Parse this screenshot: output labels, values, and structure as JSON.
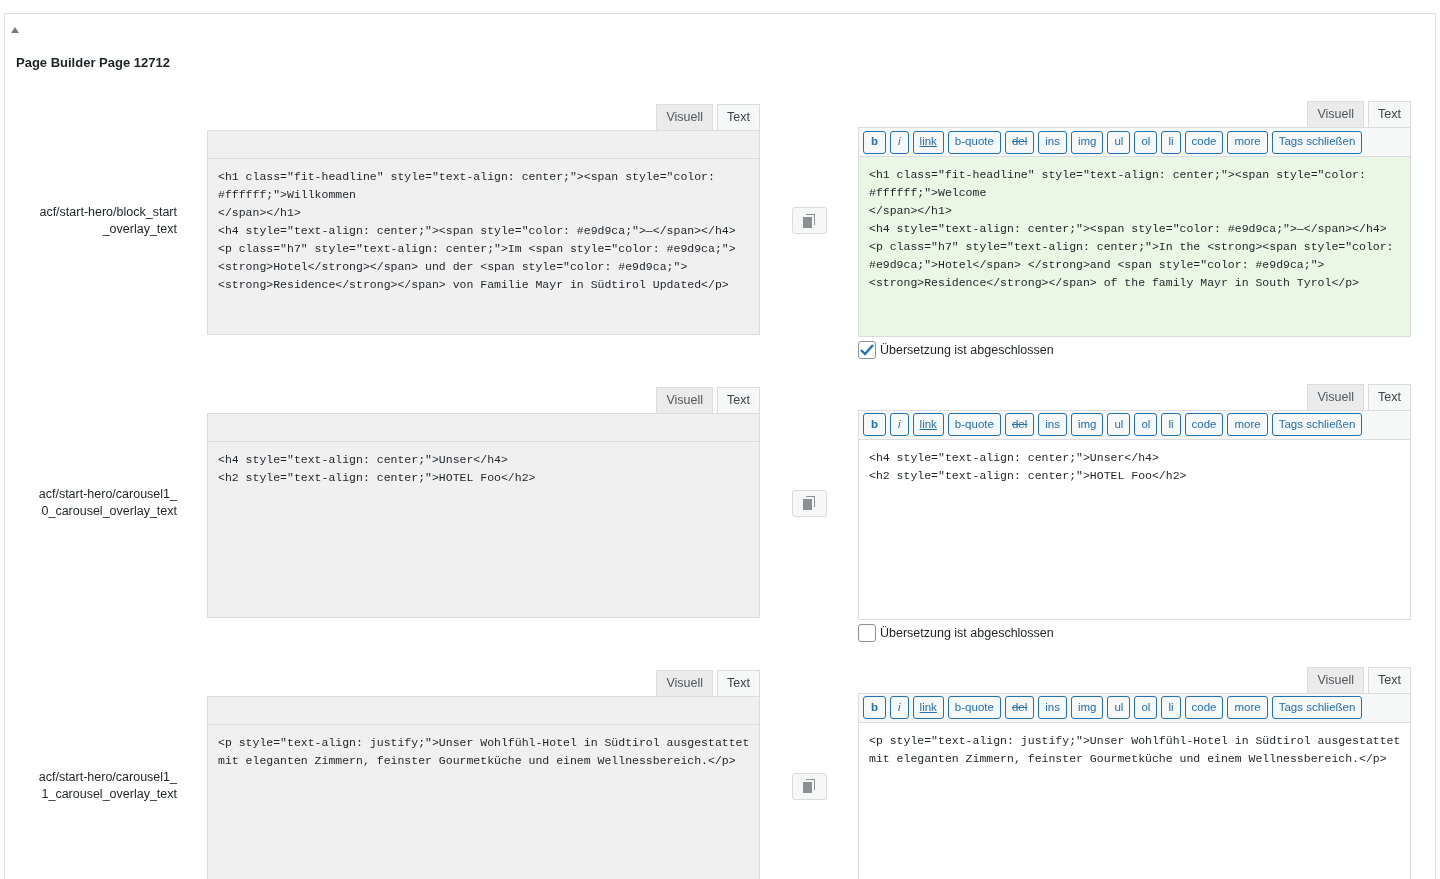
{
  "page": {
    "title": "Page Builder Page 12712"
  },
  "fields": [
    {
      "label": "acf/start-hero/block_start_overlay_text",
      "source": {
        "tabs": [
          {
            "label": "Visuell",
            "selected": false
          },
          {
            "label": "Text",
            "selected": true
          }
        ],
        "code_lines": [
          "<h1 class=\"fit-headline\" style=\"text-align: center;\"><span style=\"color:",
          "#ffffff;\">Willkommen",
          "</span></h1>",
          "<h4 style=\"text-align: center;\"><span style=\"color: #e9d9ca;\">—</span></h4>",
          "<p class=\"h7\" style=\"text-align: center;\">Im <span style=\"color: #e9d9ca;\">",
          "<strong>Hotel</strong></span> und der <span style=\"color: #e9d9ca;\">",
          "<strong>Residence</strong></span> von Familie Mayr in Südtirol Updated</p>"
        ]
      },
      "translation": {
        "tabs": [
          {
            "label": "Visuell",
            "selected": false
          },
          {
            "label": "Text",
            "selected": true
          }
        ],
        "toolbar": [
          {
            "label": "b",
            "kind": "bold"
          },
          {
            "label": "i",
            "kind": "italic"
          },
          {
            "label": "link",
            "kind": "link"
          },
          {
            "label": "b-quote",
            "kind": "plain"
          },
          {
            "label": "del",
            "kind": "strike"
          },
          {
            "label": "ins",
            "kind": "plain"
          },
          {
            "label": "img",
            "kind": "plain"
          },
          {
            "label": "ul",
            "kind": "plain"
          },
          {
            "label": "ol",
            "kind": "plain"
          },
          {
            "label": "li",
            "kind": "plain"
          },
          {
            "label": "code",
            "kind": "plain"
          },
          {
            "label": "more",
            "kind": "plain"
          },
          {
            "label": "Tags schließen",
            "kind": "plain"
          }
        ],
        "code_lines": [
          "<h1 class=\"fit-headline\" style=\"text-align: center;\"><span style=\"color:",
          "#ffffff;\">Welcome",
          "</span></h1>",
          "<h4 style=\"text-align: center;\"><span style=\"color: #e9d9ca;\">—</span></h4>",
          "<p class=\"h7\" style=\"text-align: center;\">In the <strong><span style=\"color:",
          "#e9d9ca;\">Hotel</span> </strong>and <span style=\"color: #e9d9ca;\">",
          "<strong>Residence</strong></span> of the family Mayr in South Tyrol</p>"
        ],
        "completed": {
          "label": "Übersetzung ist abgeschlossen",
          "checked": true
        }
      }
    },
    {
      "label": "acf/start-hero/carousel1_0_carousel_overlay_text",
      "source": {
        "tabs": [
          {
            "label": "Visuell",
            "selected": false
          },
          {
            "label": "Text",
            "selected": true
          }
        ],
        "code_lines": [
          "<h4 style=\"text-align: center;\">Unser</h4>",
          "<h2 style=\"text-align: center;\">HOTEL Foo</h2>"
        ]
      },
      "translation": {
        "tabs": [
          {
            "label": "Visuell",
            "selected": false
          },
          {
            "label": "Text",
            "selected": true
          }
        ],
        "toolbar": [
          {
            "label": "b",
            "kind": "bold"
          },
          {
            "label": "i",
            "kind": "italic"
          },
          {
            "label": "link",
            "kind": "link"
          },
          {
            "label": "b-quote",
            "kind": "plain"
          },
          {
            "label": "del",
            "kind": "strike"
          },
          {
            "label": "ins",
            "kind": "plain"
          },
          {
            "label": "img",
            "kind": "plain"
          },
          {
            "label": "ul",
            "kind": "plain"
          },
          {
            "label": "ol",
            "kind": "plain"
          },
          {
            "label": "li",
            "kind": "plain"
          },
          {
            "label": "code",
            "kind": "plain"
          },
          {
            "label": "more",
            "kind": "plain"
          },
          {
            "label": "Tags schließen",
            "kind": "plain"
          }
        ],
        "code_lines": [
          "<h4 style=\"text-align: center;\">Unser</h4>",
          "<h2 style=\"text-align: center;\">HOTEL Foo</h2>"
        ],
        "completed": {
          "label": "Übersetzung ist abgeschlossen",
          "checked": false
        }
      }
    },
    {
      "label": "acf/start-hero/carousel1_1_carousel_overlay_text",
      "source": {
        "tabs": [
          {
            "label": "Visuell",
            "selected": false
          },
          {
            "label": "Text",
            "selected": true
          }
        ],
        "code_lines": [
          "<p style=\"text-align: justify;\">Unser Wohlfühl-Hotel in Südtirol ausgestattet",
          "mit eleganten Zimmern, feinster Gourmetküche und einem Wellnessbereich.</p>"
        ]
      },
      "translation": {
        "tabs": [
          {
            "label": "Visuell",
            "selected": false
          },
          {
            "label": "Text",
            "selected": true
          }
        ],
        "toolbar": [
          {
            "label": "b",
            "kind": "bold"
          },
          {
            "label": "i",
            "kind": "italic"
          },
          {
            "label": "link",
            "kind": "link"
          },
          {
            "label": "b-quote",
            "kind": "plain"
          },
          {
            "label": "del",
            "kind": "strike"
          },
          {
            "label": "ins",
            "kind": "plain"
          },
          {
            "label": "img",
            "kind": "plain"
          },
          {
            "label": "ul",
            "kind": "plain"
          },
          {
            "label": "ol",
            "kind": "plain"
          },
          {
            "label": "li",
            "kind": "plain"
          },
          {
            "label": "code",
            "kind": "plain"
          },
          {
            "label": "more",
            "kind": "plain"
          },
          {
            "label": "Tags schließen",
            "kind": "plain"
          }
        ],
        "code_lines": [
          "<p style=\"text-align: justify;\">Unser Wohlfühl-Hotel in Südtirol ausgestattet",
          "mit eleganten Zimmern, feinster Gourmetküche und einem Wellnessbereich.</p>"
        ]
      }
    }
  ]
}
